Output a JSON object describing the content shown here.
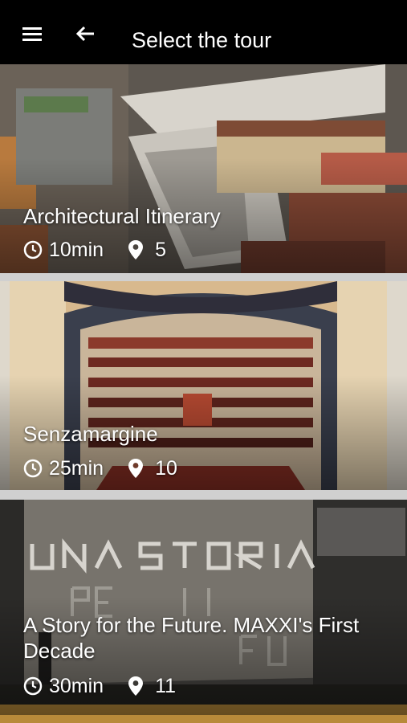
{
  "header": {
    "title": "Select the tour",
    "menu_icon": "menu-icon",
    "back_icon": "arrow-back-icon"
  },
  "tours": [
    {
      "title": "Architectural Itinerary",
      "duration": "10min",
      "stops": "5"
    },
    {
      "title": "Senzamargine",
      "duration": "25min",
      "stops": "10"
    },
    {
      "title": "A Story for the Future. MAXXI's First Decade",
      "duration": "30min",
      "stops": "11"
    }
  ],
  "colors": {
    "appbar": "#000000",
    "text": "#ffffff",
    "separator": "#d0d0d0"
  }
}
